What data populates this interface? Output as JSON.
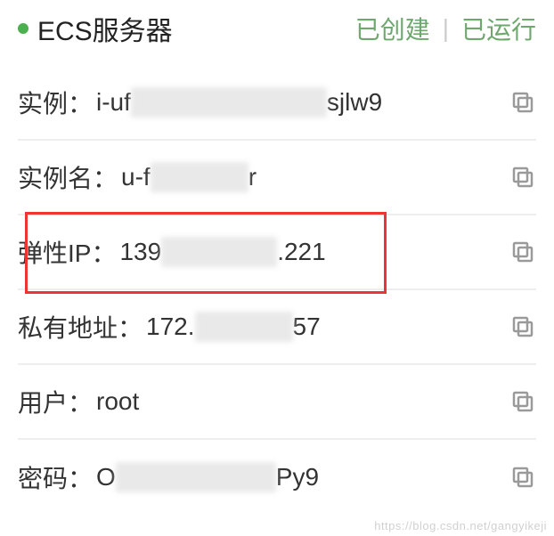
{
  "header": {
    "title": "ECS服务器",
    "status_created": "已创建",
    "status_running": "已运行"
  },
  "rows": {
    "instance": {
      "label": "实例：",
      "value_prefix": "i-uf",
      "value_suffix": "sjlw9"
    },
    "instance_name": {
      "label": "实例名：",
      "value_prefix": "u-f",
      "value_suffix": "r"
    },
    "elastic_ip": {
      "label": "弹性IP：",
      "value_prefix": "139",
      "value_suffix": ".221"
    },
    "private_addr": {
      "label": "私有地址：",
      "value_prefix": "172.",
      "value_suffix": "57"
    },
    "user": {
      "label": "用户：",
      "value": "root"
    },
    "password": {
      "label": "密码：",
      "value_prefix": "O",
      "value_suffix": "Py9"
    }
  },
  "watermark": "https://blog.csdn.net/gangyikeji"
}
